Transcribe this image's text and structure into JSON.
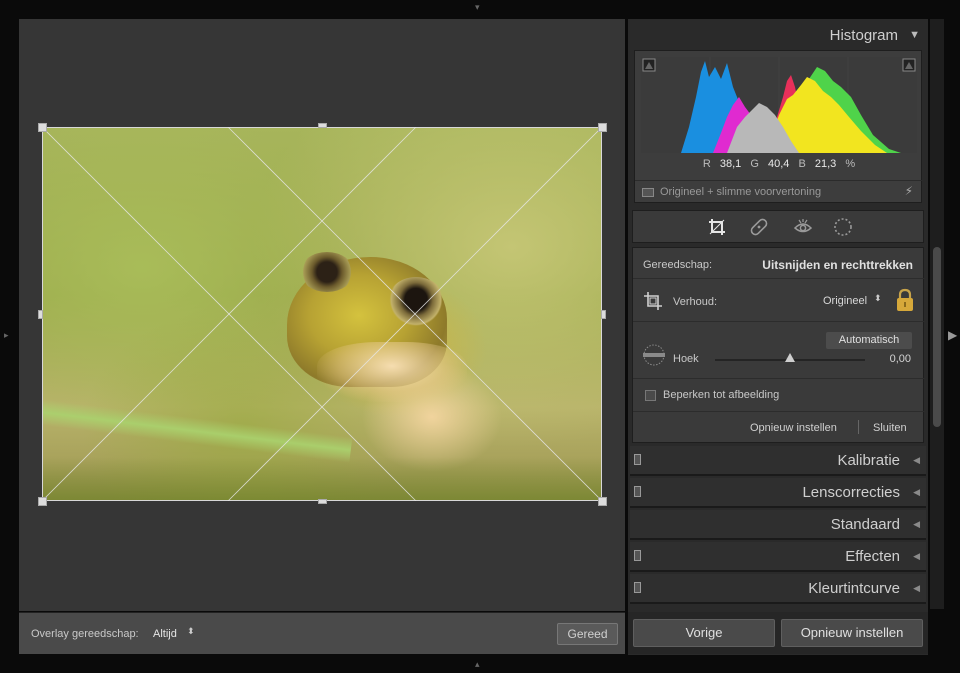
{
  "histogram": {
    "title": "Histogram",
    "readout": {
      "r_label": "R",
      "r_value": "38,1",
      "g_label": "G",
      "g_value": "40,4",
      "b_label": "B",
      "b_value": "21,3",
      "unit": "%"
    },
    "preview_label": "Origineel + slimme voorvertoning"
  },
  "crop": {
    "tool_label": "Gereedschap:",
    "tool_name": "Uitsnijden en rechttrekken",
    "aspect_label": "Verhoud:",
    "aspect_value": "Origineel",
    "auto_label": "Automatisch",
    "angle_label": "Hoek",
    "angle_value": "0,00",
    "angle_level": 0.5,
    "constrain_label": "Beperken tot afbeelding",
    "reset_label": "Opnieuw instellen",
    "close_label": "Sluiten"
  },
  "sections": [
    "Kalibratie",
    "Lenscorrecties",
    "Standaard",
    "Effecten",
    "Kleurtintcurve"
  ],
  "toolbar": {
    "overlay_label": "Overlay gereedschap:",
    "overlay_value": "Altijd",
    "done_label": "Gereed"
  },
  "bottom": {
    "prev_label": "Vorige",
    "reset_label": "Opnieuw instellen"
  },
  "colors": {
    "panel_bg": "#2a2a2a",
    "image_area_bg": "#363636",
    "hist_red": "#e8305a",
    "hist_green": "#4fd34a",
    "hist_blue": "#1a8fe0",
    "hist_yellow": "#f2e51f",
    "hist_magenta": "#e02ad0"
  }
}
